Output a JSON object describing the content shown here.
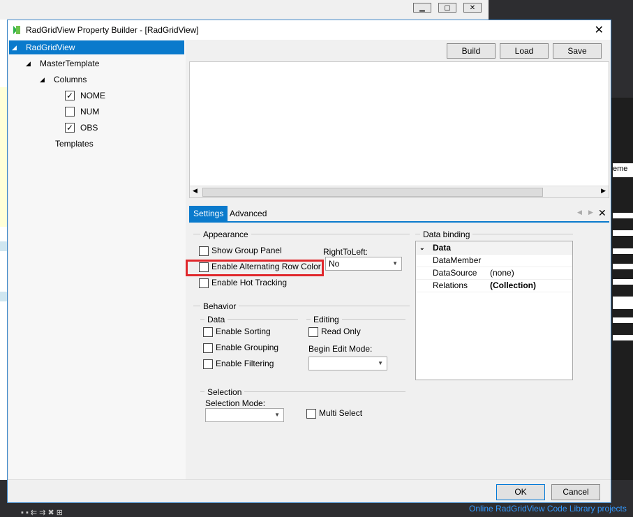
{
  "dialog": {
    "title": "RadGridView Property Builder - [RadGridView]"
  },
  "tree": {
    "root": "RadGridView",
    "master": "MasterTemplate",
    "columns": "Columns",
    "items": [
      {
        "label": "NOME",
        "checked": true
      },
      {
        "label": "NUM",
        "checked": false
      },
      {
        "label": "OBS",
        "checked": true
      }
    ],
    "templates": "Templates"
  },
  "toolbar": {
    "build": "Build",
    "load": "Load",
    "save": "Save"
  },
  "tabs": {
    "settings": "Settings",
    "advanced": "Advanced"
  },
  "appearance": {
    "title": "Appearance",
    "show_group_panel": "Show Group Panel",
    "alt_row_color": "Enable Alternating Row Color",
    "hot_tracking": "Enable Hot Tracking",
    "rtl_label": "RightToLeft:",
    "rtl_value": "No"
  },
  "behavior": {
    "title": "Behavior",
    "data_title": "Data",
    "sorting": "Enable Sorting",
    "grouping": "Enable Grouping",
    "filtering": "Enable Filtering",
    "editing_title": "Editing",
    "read_only": "Read Only",
    "begin_edit_mode": "Begin Edit Mode:"
  },
  "selection": {
    "title": "Selection",
    "mode_label": "Selection Mode:",
    "multi_select": "Multi Select"
  },
  "data_binding": {
    "title": "Data binding",
    "category": "Data",
    "rows": [
      {
        "name": "DataMember",
        "value": ""
      },
      {
        "name": "DataSource",
        "value": "(none)"
      },
      {
        "name": "Relations",
        "value": "(Collection)"
      }
    ]
  },
  "footer": {
    "ok": "OK",
    "cancel": "Cancel"
  },
  "background": {
    "online_link": "Online RadGridView Code Library projects",
    "side_text": "eme"
  }
}
